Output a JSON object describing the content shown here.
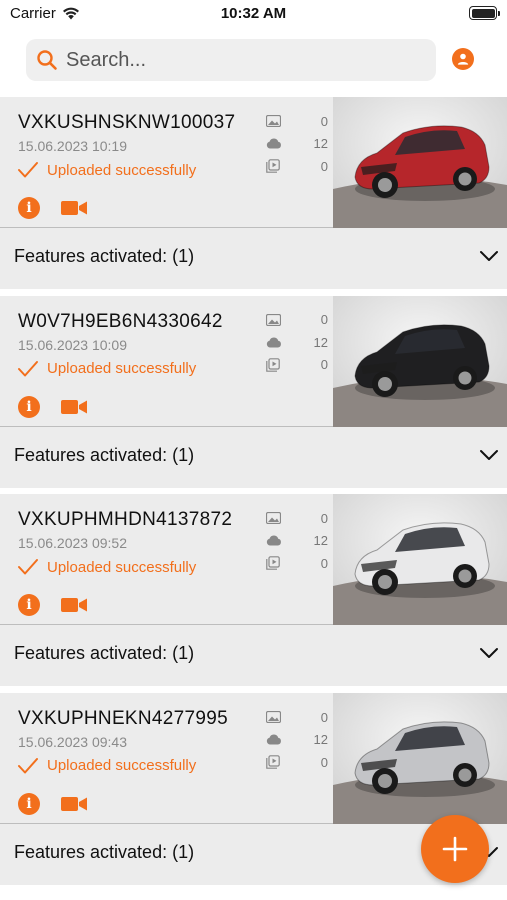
{
  "status_bar": {
    "carrier": "Carrier",
    "time": "10:32 AM"
  },
  "search": {
    "placeholder": "Search..."
  },
  "colors": {
    "accent": "#f26f1c",
    "card_bg": "#ececec",
    "muted_text": "#8a8a8a"
  },
  "vehicles": [
    {
      "vin": "VXKUSHNSKNW100037",
      "date": "15.06.2023 10:19",
      "status": "Uploaded successfully",
      "photos": "0",
      "cloud": "12",
      "videos": "0",
      "features": "Features activated: (1)",
      "car_color": "#b6262b"
    },
    {
      "vin": "W0V7H9EB6N4330642",
      "date": "15.06.2023 10:09",
      "status": "Uploaded successfully",
      "photos": "0",
      "cloud": "12",
      "videos": "0",
      "features": "Features activated: (1)",
      "car_color": "#1f1f21"
    },
    {
      "vin": "VXKUPHMHDN4137872",
      "date": "15.06.2023 09:52",
      "status": "Uploaded successfully",
      "photos": "0",
      "cloud": "12",
      "videos": "0",
      "features": "Features activated: (1)",
      "car_color": "#e9e9ea"
    },
    {
      "vin": "VXKUPHNEKN4277995",
      "date": "15.06.2023 09:43",
      "status": "Uploaded successfully",
      "photos": "0",
      "cloud": "12",
      "videos": "0",
      "features": "Features activated: (1)",
      "car_color": "#c3c4c7"
    }
  ]
}
